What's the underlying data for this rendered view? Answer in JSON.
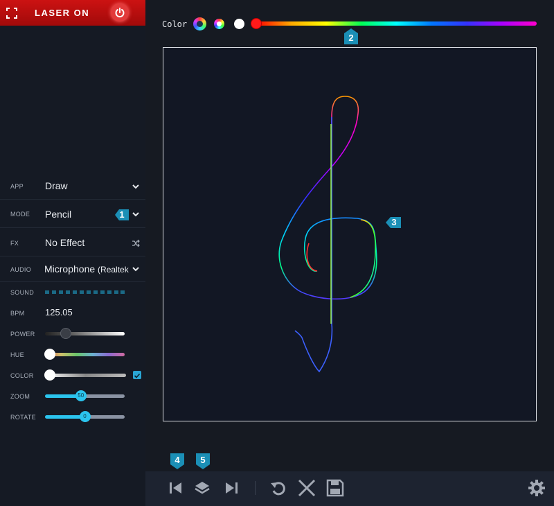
{
  "laser": {
    "label": "LASER ON"
  },
  "sidebar": {
    "app": {
      "label": "APP",
      "value": "Draw"
    },
    "mode": {
      "label": "MODE",
      "value": "Pencil"
    },
    "fx": {
      "label": "FX",
      "value": "No Effect"
    },
    "audio": {
      "label": "AUDIO",
      "value": "Microphone",
      "value_suffix": "(Realtek"
    },
    "sound": {
      "label": "SOUND"
    },
    "bpm": {
      "label": "BPM",
      "value": "125.05"
    },
    "power": {
      "label": "POWER",
      "level": 0.26
    },
    "hue": {
      "label": "HUE",
      "level": 0.06
    },
    "color": {
      "label": "COLOR",
      "level": 0.06,
      "checked": true
    },
    "zoom": {
      "label": "ZOOM",
      "value": "50",
      "level": 0.45
    },
    "rotate": {
      "label": "ROTATE",
      "value": "0",
      "level": 0.5
    }
  },
  "toolbar": {
    "color_label": "Color",
    "hue_position": 0.0
  },
  "badges": {
    "b1": "1",
    "b2": "2",
    "b3": "3",
    "b4": "4",
    "b5": "5"
  },
  "colors": {
    "laser_bar": "#c21010",
    "accent": "#2bc4ee",
    "background": "#161a22",
    "badge": "#1b8fb6"
  },
  "icons": [
    "expand-icon",
    "power-icon",
    "chevron-down-icon",
    "shuffle-icon",
    "color-wheel-icon",
    "rgb-icon",
    "white-dot-icon",
    "skip-first-icon",
    "layers-icon",
    "skip-last-icon",
    "undo-icon",
    "clear-icon",
    "save-icon",
    "gear-icon"
  ]
}
